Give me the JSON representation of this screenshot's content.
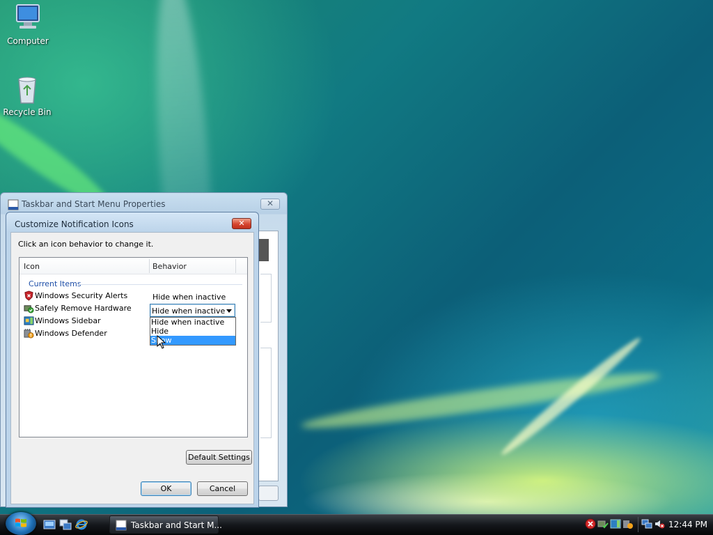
{
  "desktop": {
    "icons": [
      {
        "label": "Computer",
        "icon": "computer-icon"
      },
      {
        "label": "Recycle Bin",
        "icon": "recycle-bin-icon"
      }
    ]
  },
  "back_window": {
    "title": "Taskbar and Start Menu Properties",
    "close_glyph": "✕"
  },
  "dialog": {
    "title": "Customize Notification Icons",
    "close_glyph": "✕",
    "instruction": "Click an icon behavior to change it.",
    "columns": {
      "icon": "Icon",
      "behavior": "Behavior"
    },
    "group": "Current Items",
    "items": [
      {
        "name": "Windows Security Alerts",
        "behavior": "Hide when inactive",
        "icon": "security-shield-icon"
      },
      {
        "name": "Safely Remove Hardware",
        "behavior": "Hide when inactive",
        "icon": "safely-remove-hardware-icon"
      },
      {
        "name": "Windows Sidebar",
        "behavior": "",
        "icon": "windows-sidebar-icon"
      },
      {
        "name": "Windows Defender",
        "behavior": "",
        "icon": "windows-defender-icon"
      }
    ],
    "combo_value": "Hide when inactive",
    "dropdown_options": [
      "Hide when inactive",
      "Hide",
      "Show"
    ],
    "dropdown_selected": "Show",
    "buttons": {
      "default_settings": "Default Settings",
      "ok": "OK",
      "cancel": "Cancel"
    }
  },
  "taskbar": {
    "task_button_label": "Taskbar and Start M...",
    "clock": "12:44 PM",
    "quick_launch": [
      "show-desktop-icon",
      "switch-windows-icon",
      "internet-explorer-icon"
    ],
    "tray_icons": [
      "security-alert-tray-icon",
      "safely-remove-hardware-tray-icon",
      "windows-sidebar-tray-icon",
      "windows-defender-tray-icon",
      "network-tray-icon",
      "volume-muted-tray-icon"
    ]
  },
  "colors": {
    "selection": "#3399ff",
    "group_header": "#1f4fa8",
    "close_button": "#d6452f"
  }
}
